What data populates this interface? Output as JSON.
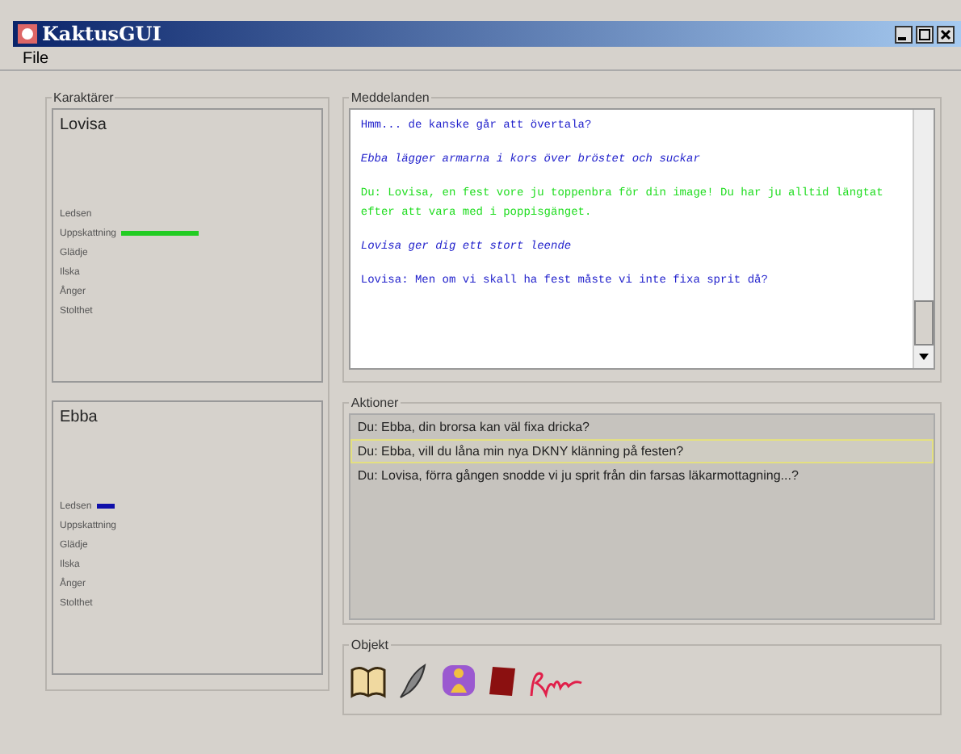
{
  "window": {
    "title": "KaktusGUI"
  },
  "menu": [
    "File"
  ],
  "characters": {
    "title": "Karaktärer",
    "list": [
      {
        "name": "Lovisa",
        "color": "#22cc22",
        "traits": [
          {
            "kind": "plain",
            "label": "Ledsen"
          },
          {
            "kind": "longbar",
            "label": "Uppskattning"
          },
          {
            "kind": "plain",
            "label": "Glädje"
          },
          {
            "kind": "plain",
            "label": "Ilska"
          },
          {
            "kind": "plain",
            "label": "Ånger"
          },
          {
            "kind": "plain",
            "label": "Stolthet"
          }
        ]
      },
      {
        "name": "Ebba",
        "color": "#1010aa",
        "traits": [
          {
            "kind": "shortbar",
            "label": "Ledsen"
          },
          {
            "kind": "plain",
            "label": "Uppskattning"
          },
          {
            "kind": "plain",
            "label": "Glädje"
          },
          {
            "kind": "plain",
            "label": "Ilska"
          },
          {
            "kind": "plain",
            "label": "Ånger"
          },
          {
            "kind": "plain",
            "label": "Stolthet"
          }
        ]
      }
    ]
  },
  "messages": {
    "title": "Meddelanden",
    "list": [
      {
        "kind": "speech",
        "color": "#2222cc",
        "text": "Hmm... de kanske går att övertala?"
      },
      {
        "kind": "action",
        "color": "#2222cc",
        "text": "Ebba lägger armarna i kors över bröstet och suckar"
      },
      {
        "kind": "speech",
        "color": "#22dd22",
        "text": "Du: Lovisa, en fest vore ju toppenbra för din image! Du har ju alltid längtat efter att vara med i poppisgänget."
      },
      {
        "kind": "action",
        "color": "#2222cc",
        "text": "Lovisa ger dig ett stort leende"
      },
      {
        "kind": "speech",
        "color": "#2222cc",
        "text": "Lovisa: Men om vi skall ha fest måste vi inte fixa sprit då?"
      }
    ]
  },
  "actions": {
    "title": "Aktioner",
    "list": [
      {
        "text": "Du: Ebba, din brorsa kan väl fixa dricka?",
        "selected": false
      },
      {
        "text": "Du: Ebba, vill du låna min nya DKNY klänning på festen?",
        "selected": true
      },
      {
        "text": "Du: Lovisa, förra gången snodde vi ju sprit från din farsas läkarmottagning...?",
        "selected": false
      }
    ]
  },
  "objects": {
    "title": "Objekt",
    "list": [
      {
        "kind": "book"
      },
      {
        "kind": "feather"
      },
      {
        "kind": "figure"
      },
      {
        "kind": "redbook"
      },
      {
        "kind": "signature"
      }
    ]
  }
}
